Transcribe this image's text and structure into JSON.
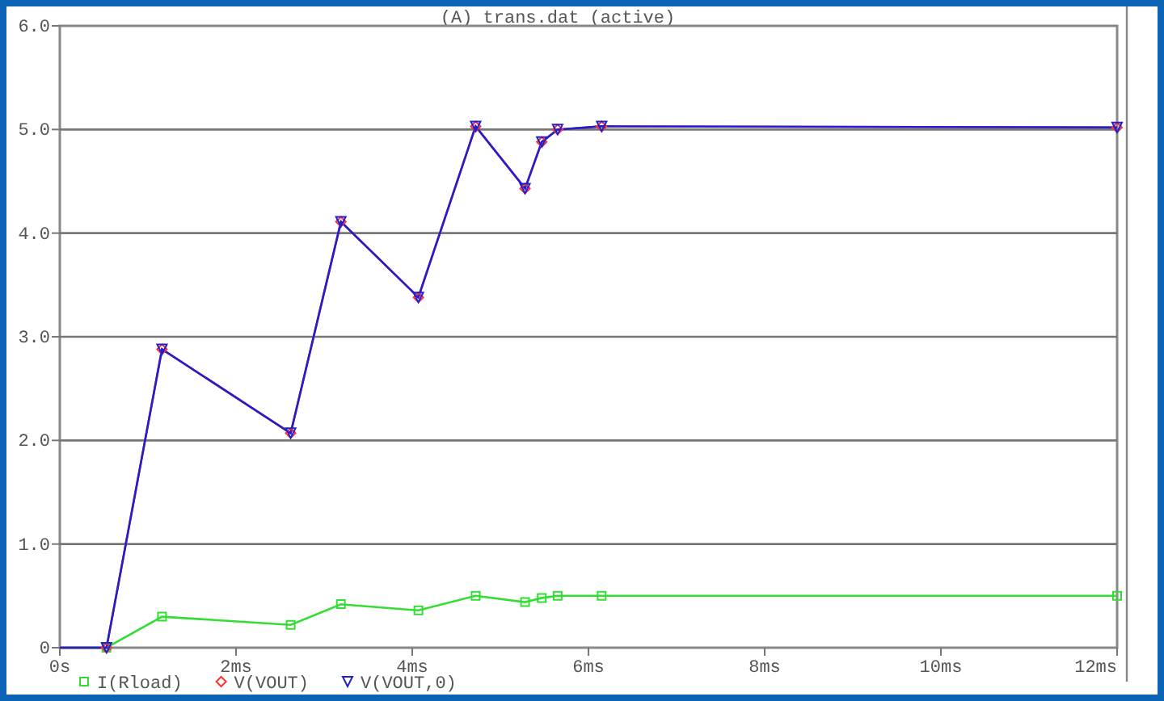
{
  "window": {
    "title": "(A) trans.dat (active)"
  },
  "chart": {
    "chart_data": {
      "type": "line",
      "x": [
        0,
        0.53,
        1.16,
        2.62,
        3.19,
        4.07,
        4.72,
        5.28,
        5.47,
        5.65,
        6.15,
        12
      ],
      "series": [
        {
          "name": "I(Rload)",
          "color": "#33dd33",
          "marker": "square",
          "values": [
            0,
            0,
            0.3,
            0.22,
            0.42,
            0.36,
            0.5,
            0.44,
            0.48,
            0.5,
            0.5,
            0.5
          ]
        },
        {
          "name": "V(VOUT)",
          "color": "#ff3030",
          "marker": "diamond",
          "values": [
            0,
            0,
            2.88,
            2.07,
            4.11,
            3.38,
            5.03,
            4.43,
            4.88,
            5.0,
            5.03,
            5.02
          ]
        },
        {
          "name": "V(VOUT,0)",
          "color": "#2020d0",
          "marker": "triangle",
          "values": [
            0,
            0,
            2.88,
            2.07,
            4.11,
            3.38,
            5.03,
            4.43,
            4.88,
            5.0,
            5.03,
            5.02
          ]
        }
      ],
      "grid": true,
      "legend": "bottom",
      "xlim": [
        0,
        12
      ],
      "ylim": [
        0,
        6
      ],
      "xticks": [
        {
          "value": 0,
          "label": "0s"
        },
        {
          "value": 2,
          "label": "2ms"
        },
        {
          "value": 4,
          "label": "4ms"
        },
        {
          "value": 6,
          "label": "6ms"
        },
        {
          "value": 8,
          "label": "8ms"
        },
        {
          "value": 10,
          "label": "10ms"
        },
        {
          "value": 12,
          "label": "12ms"
        }
      ],
      "yticks": [
        {
          "value": 0,
          "label": "0"
        },
        {
          "value": 1,
          "label": "1.0"
        },
        {
          "value": 2,
          "label": "2.0"
        },
        {
          "value": 3,
          "label": "3.0"
        },
        {
          "value": 4,
          "label": "4.0"
        },
        {
          "value": 5,
          "label": "5.0"
        },
        {
          "value": 6,
          "label": "6.0"
        }
      ]
    }
  }
}
